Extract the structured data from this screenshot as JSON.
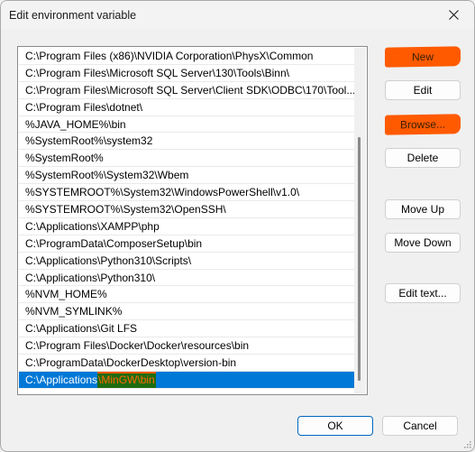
{
  "window": {
    "title": "Edit environment variable",
    "close_icon": "close-icon"
  },
  "path_list": {
    "items": [
      "C:\\Program Files (x86)\\NVIDIA Corporation\\PhysX\\Common",
      "C:\\Program Files\\Microsoft SQL Server\\130\\Tools\\Binn\\",
      "C:\\Program Files\\Microsoft SQL Server\\Client SDK\\ODBC\\170\\Tool...",
      "C:\\Program Files\\dotnet\\",
      "%JAVA_HOME%\\bin",
      "%SystemRoot%\\system32",
      "%SystemRoot%",
      "%SystemRoot%\\System32\\Wbem",
      "%SYSTEMROOT%\\System32\\WindowsPowerShell\\v1.0\\",
      "%SYSTEMROOT%\\System32\\OpenSSH\\",
      "C:\\Applications\\XAMPP\\php",
      "C:\\ProgramData\\ComposerSetup\\bin",
      "C:\\Applications\\Python310\\Scripts\\",
      "C:\\Applications\\Python310\\",
      "%NVM_HOME%",
      "%NVM_SYMLINK%",
      "C:\\Applications\\Git LFS",
      "C:\\Program Files\\Docker\\Docker\\resources\\bin",
      "C:\\ProgramData\\DockerDesktop\\version-bin"
    ],
    "selected": {
      "prefix": "C:\\Applications",
      "highlighted": "\\MinGW\\bin"
    },
    "selection_color": "#0078d7",
    "annotation_color": "#ff5a00"
  },
  "buttons": {
    "new": "New",
    "edit": "Edit",
    "browse": "Browse...",
    "delete": "Delete",
    "move_up": "Move Up",
    "move_down": "Move Down",
    "edit_text": "Edit text...",
    "ok": "OK",
    "cancel": "Cancel"
  }
}
